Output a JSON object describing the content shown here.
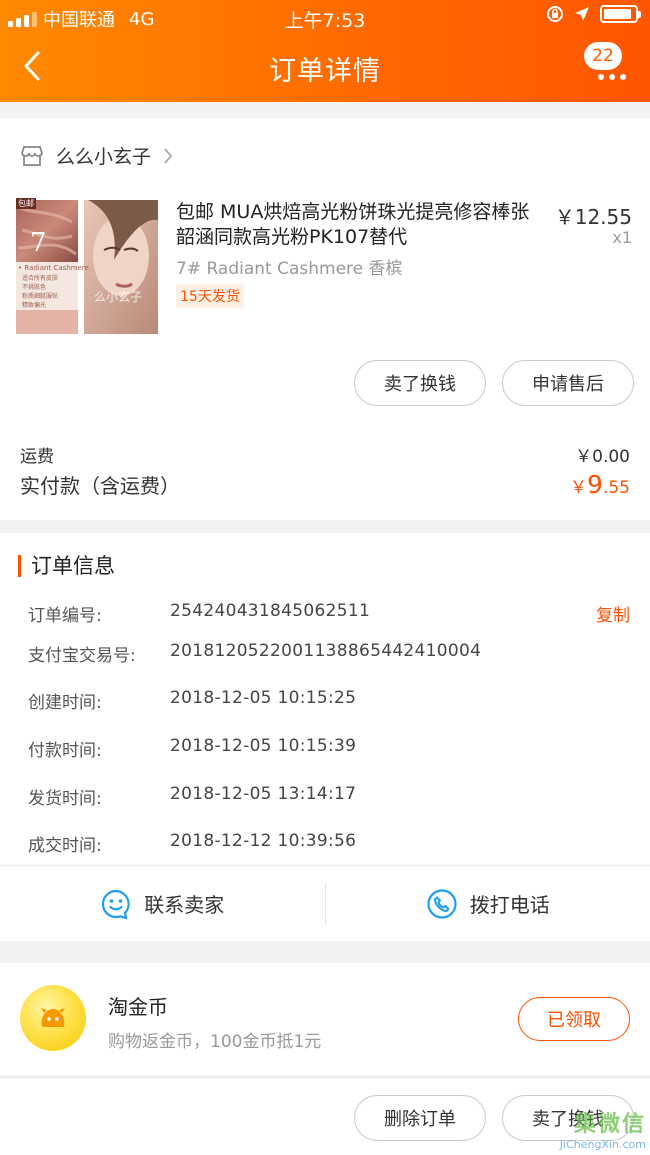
{
  "status_bar": {
    "carrier": "中国联通",
    "network": "4G",
    "time": "上午7:53",
    "battery_level": 0.9
  },
  "nav": {
    "title": "订单详情",
    "badge_count": "22"
  },
  "shop": {
    "name": "么么小玄子"
  },
  "product": {
    "title": "包邮 MUA烘焙高光粉饼珠光提亮修容棒张韶涵同款高光粉PK107替代",
    "price": "￥12.55",
    "quantity": "x1",
    "sku": "7# Radiant Cashmere 香槟",
    "tag": "15天发货",
    "thumb_text": {
      "ribbon": "包邮",
      "number": "7",
      "name": "• Radiant Cashmere",
      "notes": [
        "适合所有皮肤",
        "不挑肤色",
        "粉质细腻服帖",
        "精致偏光"
      ],
      "watermark": "么小玄子"
    }
  },
  "item_actions": {
    "sell": "卖了换钱",
    "after_sale": "申请售后"
  },
  "fees": {
    "shipping_label": "运费",
    "shipping_value": "￥0.00",
    "paid_label": "实付款（含运费）",
    "paid_currency": "￥",
    "paid_int": "9",
    "paid_dec": ".55"
  },
  "order_info": {
    "title": "订单信息",
    "copy_label": "复制",
    "rows": [
      {
        "label": "订单编号:",
        "value": "254240431845062511"
      },
      {
        "label": "支付宝交易号:",
        "value": "2018120522001138865442410004"
      },
      {
        "label": "创建时间:",
        "value": "2018-12-05 10:15:25"
      },
      {
        "label": "付款时间:",
        "value": "2018-12-05 10:15:39"
      },
      {
        "label": "发货时间:",
        "value": "2018-12-05 13:14:17"
      },
      {
        "label": "成交时间:",
        "value": "2018-12-12 10:39:56"
      }
    ]
  },
  "contact": {
    "seller": "联系卖家",
    "call": "拨打电话"
  },
  "coins": {
    "title": "淘金币",
    "subtitle": "购物返金币，100金币抵1元",
    "button": "已领取"
  },
  "bottom": {
    "delete": "删除订单",
    "sell": "卖了换钱"
  },
  "watermark": {
    "text": "集微信",
    "domain": "JiChengXin.com"
  },
  "colors": {
    "accent": "#ff5000",
    "header_start": "#ff8a00",
    "header_end": "#ff5500"
  }
}
